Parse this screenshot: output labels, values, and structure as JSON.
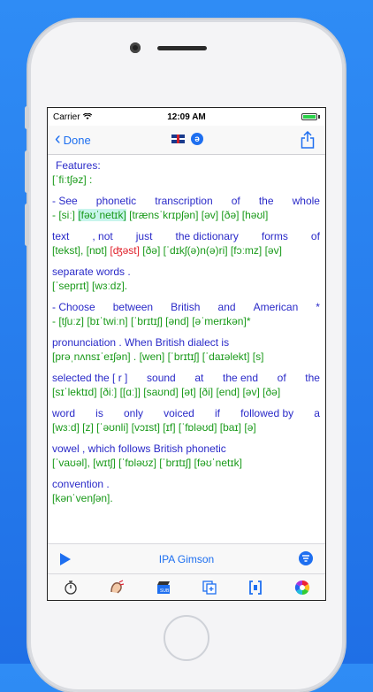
{
  "status": {
    "carrier": "Carrier",
    "time": "12:09 AM"
  },
  "nav": {
    "back_label": "Done",
    "schwa_glyph": "ə"
  },
  "lines": [
    {
      "cls": "blue",
      "text": "Features:",
      "indent": true
    },
    {
      "cls": "green",
      "text": "[ˈfiːtʃəz]    :"
    },
    {
      "spacer": true
    },
    {
      "cls": "blue",
      "row": [
        "-  See",
        "phonetic",
        "transcription",
        "of",
        "the",
        "whole"
      ]
    },
    {
      "cls": "green",
      "parts": [
        {
          "t": "- [siː]  "
        },
        {
          "t": "[fəʊˈnetɪk]",
          "cls": "hl"
        },
        {
          "t": "  [trænsˈkrɪpʃən]  [əv]  [ðə]  [həʊl]"
        }
      ]
    },
    {
      "spacer": true
    },
    {
      "cls": "blue",
      "row": [
        "text",
        ",  not",
        "just",
        "the dictionary",
        "forms",
        "of"
      ]
    },
    {
      "cls": "green",
      "parts": [
        {
          "t": "[tekst],  [nɒt]  "
        },
        {
          "t": "[ʤəst]",
          "cls": "red"
        },
        {
          "t": " [ðə]  [ˈdɪkʃ(ə)n(ə)ri]  [fɔːmz]  [əv]"
        }
      ]
    },
    {
      "spacer": true
    },
    {
      "cls": "blue",
      "text": "separate  words ."
    },
    {
      "cls": "green",
      "text": "[ˈseprɪt]     [wɜːdz]."
    },
    {
      "spacer": true
    },
    {
      "cls": "blue",
      "row": [
        "-  Choose",
        "between",
        "British",
        "and",
        "American",
        "*"
      ]
    },
    {
      "cls": "green",
      "text": "- [tʃuːz]     [bɪˈtwiːn]    [ˈbrɪtɪʃ]   [ənd]  [əˈmerɪkən]*"
    },
    {
      "spacer": true
    },
    {
      "cls": "blue",
      "text": "pronunciation  .  When  British  dialect    is"
    },
    {
      "cls": "green",
      "text": "[prəˌnʌnsɪˈeɪʃən] . [wen]    [ˈbrɪtɪʃ]  [ˈdaɪəlekt]  [s]"
    },
    {
      "spacer": true
    },
    {
      "cls": "blue",
      "row": [
        "selected the [ r ]",
        "sound",
        "at",
        "the end",
        "of",
        "the"
      ]
    },
    {
      "cls": "green",
      "text": "[sɪˈlektɪd]  [ðiː]  [[ɑː]]  [saʊnd]  [ət]  [ði]   [end]  [əv]  [ðə]"
    },
    {
      "spacer": true
    },
    {
      "cls": "blue",
      "row": [
        "word",
        "is",
        "only",
        "voiced",
        "if",
        "followed by",
        "a"
      ]
    },
    {
      "cls": "green",
      "text": "[wɜːd]  [z]  [ˈəʊnli]  [vɔɪst]    [ɪf]   [ˈfɒləʊd]  [baɪ]   [ə]"
    },
    {
      "spacer": true
    },
    {
      "cls": "blue",
      "text": "vowel ,  which follows  British  phonetic"
    },
    {
      "cls": "green",
      "text": "[ˈvaʊəl],  [wɪtʃ]    [ˈfɒləʊz]  [ˈbrɪtɪʃ]  [fəʊˈnetɪk]"
    },
    {
      "spacer": true
    },
    {
      "cls": "blue",
      "text": "convention ."
    },
    {
      "cls": "green",
      "text": "[kənˈvenʃən]."
    }
  ],
  "player": {
    "title": "IPA Gimson"
  },
  "colors": {
    "accent": "#1e6ff0",
    "blue_text": "#2a2ac8",
    "green_text": "#1a9a1a",
    "red_text": "#e0202a",
    "highlight": "#c8f5ec"
  },
  "toolbar": [
    "stopwatch-icon",
    "speaker-face-icon",
    "clapperboard-sub-icon",
    "copy-plus-icon",
    "bracket-icon",
    "color-wheel-icon"
  ]
}
